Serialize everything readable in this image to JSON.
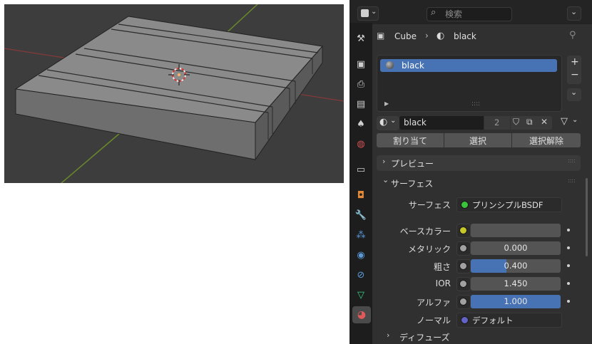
{
  "header": {
    "search_placeholder": "検索"
  },
  "breadcrumb": {
    "object": "Cube",
    "separator": "›",
    "material": "black"
  },
  "material_slots": {
    "items": [
      {
        "name": "black"
      }
    ]
  },
  "material_selector": {
    "name": "black",
    "users": "2"
  },
  "slot_buttons": {
    "assign": "割り当て",
    "select": "選択",
    "deselect": "選択解除"
  },
  "sections": {
    "preview": "プレビュー",
    "surface": "サーフェス",
    "diffuse": "ディフューズ"
  },
  "surface": {
    "shader_label": "サーフェス",
    "shader_value": "プリンシプルBSDF",
    "props": [
      {
        "label": "ベースカラー",
        "value": "",
        "fill": 0,
        "socket_color": "#c7c729"
      },
      {
        "label": "メタリック",
        "value": "0.000",
        "fill": 0,
        "socket_color": "#a1a1a1"
      },
      {
        "label": "粗さ",
        "value": "0.400",
        "fill": 0.4,
        "socket_color": "#a1a1a1"
      },
      {
        "label": "IOR",
        "value": "1.450",
        "fill": 0,
        "socket_color": "#a1a1a1"
      },
      {
        "label": "アルファ",
        "value": "1.000",
        "fill": 1,
        "socket_color": "#a1a1a1"
      }
    ],
    "normal_label": "ノーマル",
    "normal_value": "デフォルト"
  },
  "colors": {
    "accent": "#4772b3",
    "panel_bg": "#303030",
    "viewport_bg": "#3d3d3d"
  }
}
